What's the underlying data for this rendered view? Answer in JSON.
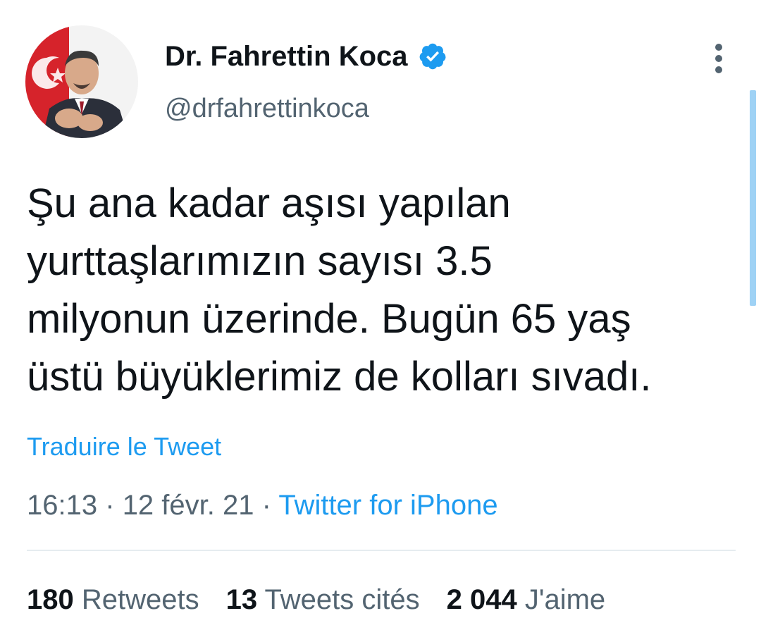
{
  "author": {
    "display_name": "Dr. Fahrettin Koca",
    "handle": "@drfahrettinkoca",
    "avatar_icon": "profile-photo",
    "verified_icon": "verified-badge-icon"
  },
  "tweet": {
    "lines": [
      "Şu ana kadar aşısı yapılan",
      "yurttaşlarımızın sayısı 3.5",
      "milyonun üzerinde. Bugün 65 yaş",
      "üstü büyüklerimiz de kolları sıvadı."
    ]
  },
  "translate_label": "Traduire le Tweet",
  "meta": {
    "time": "16:13",
    "separator": "·",
    "date": "12 févr. 21",
    "source": "Twitter for iPhone"
  },
  "stats": {
    "retweets": {
      "count": "180",
      "label": "Retweets"
    },
    "quotes": {
      "count": "13",
      "label": "Tweets cités"
    },
    "likes": {
      "count": "2 044",
      "label": "J'aime"
    }
  },
  "colors": {
    "accent": "#1d9bf0",
    "secondary_text": "#536471",
    "primary_text": "#0f1419",
    "divider": "#e6ecf0",
    "scrollbar": "#9fd2f5"
  }
}
